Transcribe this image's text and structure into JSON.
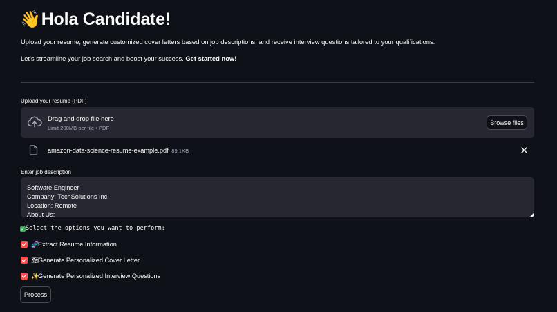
{
  "header": {
    "emoji": "👋",
    "title": "Hola Candidate!"
  },
  "intro": {
    "paragraph1": "Upload your resume, generate customized cover letters based on job descriptions, and receive interview questions tailored to your qualifications.",
    "paragraph2_text": "Let's streamline your job search and boost your success. ",
    "paragraph2_bold": "Get started now!"
  },
  "uploader": {
    "label": "Upload your resume (PDF)",
    "drop_title": "Drag and drop file here",
    "drop_limit": "Limit 200MB per file • PDF",
    "browse_label": "Browse files",
    "icon": "cloud-upload-icon",
    "file": {
      "name": "amazon-data-science-resume-example.pdf",
      "size": "89.1KB",
      "icon": "file-icon"
    }
  },
  "job_description": {
    "label": "Enter job description",
    "lines": [
      "Software Engineer",
      "Company: TechSolutions Inc.",
      "Location: Remote",
      "About Us:"
    ]
  },
  "options": {
    "heading_emoji": "✓",
    "heading": "Select the options you want to perform:",
    "items": [
      {
        "emoji": "🧬",
        "label": "Extract Resume Information",
        "checked": true
      },
      {
        "emoji": "🗺",
        "label": "Generate Personalized Cover Letter",
        "checked": true
      },
      {
        "emoji": "✨",
        "label": "Generate Personalized Interview Questions",
        "checked": true
      }
    ]
  },
  "process_label": "Process",
  "colors": {
    "background": "#0e1117",
    "panel": "#262730",
    "checkbox": "#ff4b4b",
    "text": "#fafafa",
    "muted": "#a3a8b8"
  }
}
